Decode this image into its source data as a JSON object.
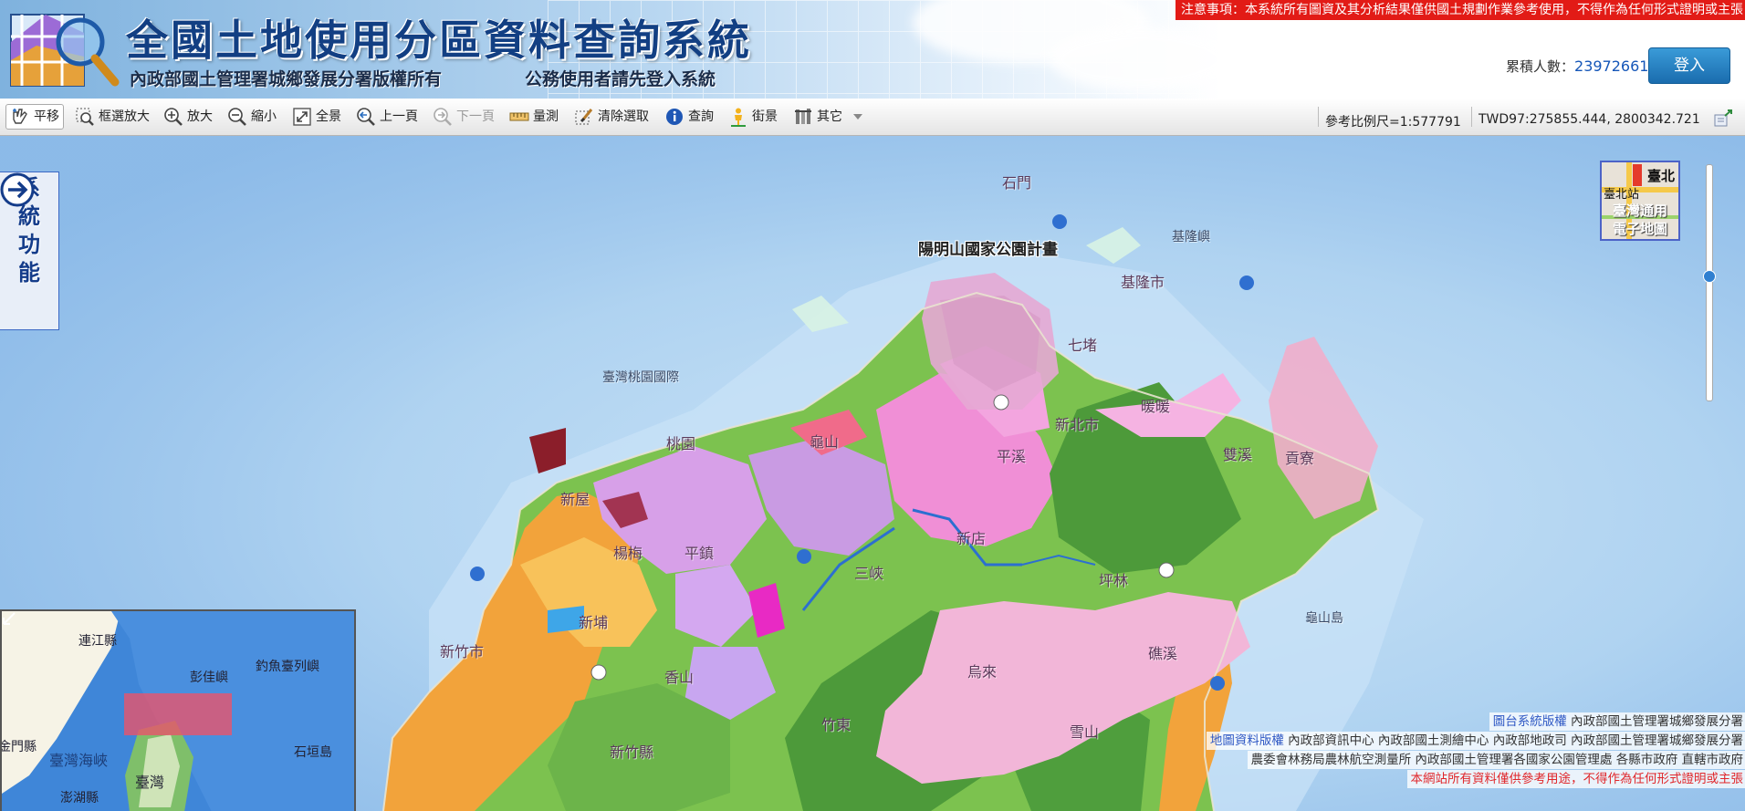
{
  "header": {
    "title": "全國土地使用分區資料查詢系統",
    "subtitle_owner": "內政部國土管理署城鄉發展分署版權所有",
    "subtitle_login_hint": "公務使用者請先登入系統",
    "notice": "注意事項：本系統所有圖資及其分析結果僅供國土規劃作業參考使用，不得作為任何形式證明或主張",
    "visit_label": "累積人數：",
    "visit_count": "23972661",
    "login_label": "登入"
  },
  "toolbar": {
    "pan": "平移",
    "box_zoom": "框選放大",
    "zoom_in": "放大",
    "zoom_out": "縮小",
    "full_extent": "全景",
    "prev_page": "上一頁",
    "next_page": "下一頁",
    "measure": "量測",
    "clear_selection": "清除選取",
    "query": "查詢",
    "street_view": "街景",
    "other": "其它",
    "scale": "參考比例尺=1:577791",
    "coordinates": "TWD97:275855.444, 2800342.721"
  },
  "side_panel": {
    "chars": [
      "系",
      "統",
      "功",
      "能"
    ]
  },
  "basemap": {
    "line1": "臺灣通用",
    "line2": "電子地圖",
    "station": "臺北站",
    "tag": "臺北"
  },
  "map_labels": {
    "yangmingshan": "陽明山國家公園計畫",
    "shimen": "石門",
    "keelung_island": "基隆嶼",
    "keelung_city": "基隆市",
    "qidu": "七堵",
    "nuannuan": "暖暖",
    "new_taipei": "新北市",
    "guishan": "龜山",
    "taoyuan": "桃園",
    "airport": "臺灣桃園國際",
    "xinwu": "新屋",
    "yangmei": "楊梅",
    "pingzhen": "平鎮",
    "xinpu": "新埔",
    "hsinchu_city": "新竹市",
    "hsinchu_county": "新竹縣",
    "xiangshan": "香山",
    "sanxia": "三峽",
    "xindian": "新店",
    "pinglin": "坪林",
    "wulai": "烏來",
    "gongliao": "貢寮",
    "guishan_island": "龜山島",
    "jiaoxi": "礁溪",
    "zhudong": "竹東",
    "xueshan": "雪山",
    "shuangxi": "雙溪",
    "pingxi": "平溪"
  },
  "overview_labels": {
    "lianjiang": "連江縣",
    "pengjia": "彭佳嶼",
    "diaoyutai": "釣魚臺列嶼",
    "kinmen": "金門縣",
    "strait": "臺灣海峽",
    "taiwan": "臺灣",
    "shigaki": "石垣島",
    "penghu": "澎湖縣"
  },
  "credits": {
    "platform_key": "圖台系統版權",
    "platform_val": "內政部國土管理署城鄉發展分署",
    "map_key": "地圖資料版權",
    "map_val": "內政部資訊中心 內政部國土測繪中心 內政部地政司 內政部國土管理署城鄉發展分署",
    "map_val2": "農委會林務局農林航空測量所 內政部國土管理署各國家公園管理處 各縣市政府 直轄市政府",
    "warning": "本網站所有資料僅供參考用途，不得作為任何形式證明或主張"
  },
  "colors": {
    "title": "#123f83",
    "notice_bg": "#e21b16",
    "login_bg": "#1a6cae",
    "sea": "#9cc6ec",
    "forest": "#4d9a3a",
    "agriculture": "#7cc24f",
    "urban": "#f2a33b",
    "park": "#eaa6d4",
    "special": "#d7a0e8"
  }
}
